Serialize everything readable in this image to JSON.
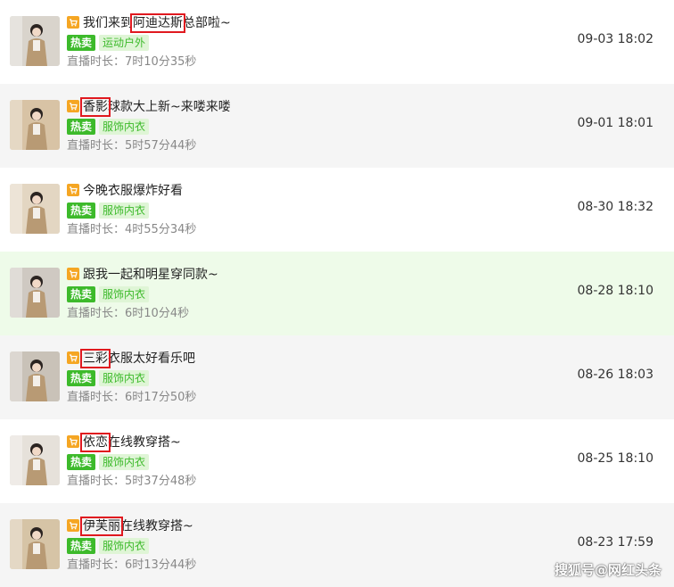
{
  "colors": {
    "hot_tag": "#3dba2b",
    "category_bg": "#dff5d6",
    "highlight_row": "#eefbe9",
    "alt_row": "#f5f5f5",
    "marker": "#e0191f",
    "cart_icon": "#f5a623"
  },
  "duration_label": "直播时长：",
  "sessions": [
    {
      "title_before": "我们来到",
      "title_mark": "阿迪达斯",
      "title_after": "总部啦~",
      "hot": "热卖",
      "category": "运动户外",
      "duration": "7时10分35秒",
      "date": "09-03 18:02",
      "thumb": "#d9d4cc"
    },
    {
      "title_before": "",
      "title_mark": "香影",
      "title_after": "球款大上新~来喽来喽",
      "hot": "热卖",
      "category": "服饰内衣",
      "duration": "5时57分44秒",
      "date": "09-01 18:01",
      "thumb": "#d8c3a5"
    },
    {
      "title_before": "今晚衣服爆炸好看",
      "title_mark": "",
      "title_after": "",
      "hot": "热卖",
      "category": "服饰内衣",
      "duration": "4时55分34秒",
      "date": "08-30 18:32",
      "thumb": "#e3d6c2"
    },
    {
      "title_before": "跟我一起和明星穿同款~",
      "title_mark": "",
      "title_after": "",
      "hot": "热卖",
      "category": "服饰内衣",
      "duration": "6时10分4秒",
      "date": "08-28 18:10",
      "thumb": "#cfc9c2"
    },
    {
      "title_before": "",
      "title_mark": "三彩",
      "title_after": "衣服太好看乐吧",
      "hot": "热卖",
      "category": "服饰内衣",
      "duration": "6时17分50秒",
      "date": "08-26 18:03",
      "thumb": "#c9c2b8"
    },
    {
      "title_before": "",
      "title_mark": "依恋",
      "title_after": "在线教穿搭~",
      "hot": "热卖",
      "category": "服饰内衣",
      "duration": "5时37分48秒",
      "date": "08-25 18:10",
      "thumb": "#e6e1da"
    },
    {
      "title_before": "",
      "title_mark": "伊芙丽",
      "title_after": "在线教穿搭~",
      "hot": "热卖",
      "category": "服饰内衣",
      "duration": "6时13分44秒",
      "date": "08-23 17:59",
      "thumb": "#d6c4a6"
    }
  ],
  "watermark": "搜狐号@网红头条"
}
